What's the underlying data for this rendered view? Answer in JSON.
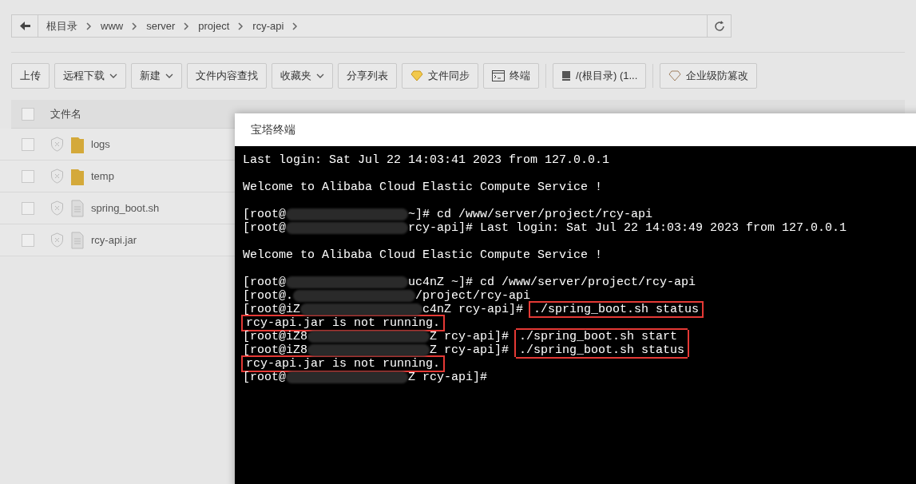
{
  "breadcrumb": [
    "根目录",
    "www",
    "server",
    "project",
    "rcy-api"
  ],
  "toolbar": [
    {
      "label": "上传",
      "kind": "plain"
    },
    {
      "label": "远程下载",
      "kind": "dropdown"
    },
    {
      "label": "新建",
      "kind": "dropdown"
    },
    {
      "label": "文件内容查找",
      "kind": "plain"
    },
    {
      "label": "收藏夹",
      "kind": "dropdown"
    },
    {
      "label": "分享列表",
      "kind": "plain"
    },
    {
      "label": "文件同步",
      "kind": "gem"
    },
    {
      "label": "终端",
      "kind": "terminal"
    },
    {
      "label": "/(根目录) (1...",
      "kind": "disk",
      "divider_before": true
    },
    {
      "label": "企业级防篡改",
      "kind": "shield",
      "divider_before": true
    }
  ],
  "table": {
    "columns": [
      "文件名"
    ],
    "all_checked": false,
    "rows": [
      {
        "name": "logs",
        "kind": "folder",
        "checked": false
      },
      {
        "name": "temp",
        "kind": "folder",
        "checked": false
      },
      {
        "name": "spring_boot.sh",
        "kind": "file",
        "checked": false
      },
      {
        "name": "rcy-api.jar",
        "kind": "file",
        "checked": false
      }
    ]
  },
  "terminal": {
    "title": "宝塔终端",
    "lines": [
      {
        "kind": "text",
        "parts": [
          {
            "kind": "plain",
            "text": "Last login: Sat Jul 22 14:03:41 2023 from 127.0.0.1"
          }
        ]
      },
      {
        "kind": "blank"
      },
      {
        "kind": "text",
        "parts": [
          {
            "kind": "plain",
            "text": "Welcome to Alibaba Cloud Elastic Compute Service !"
          }
        ]
      },
      {
        "kind": "blank"
      },
      {
        "kind": "text",
        "parts": [
          {
            "kind": "plain",
            "text": "[root@"
          },
          {
            "kind": "redacted"
          },
          {
            "kind": "plain",
            "text": "~]# cd /www/server/project/rcy-api"
          }
        ]
      },
      {
        "kind": "text",
        "parts": [
          {
            "kind": "plain",
            "text": "[root@"
          },
          {
            "kind": "redacted"
          },
          {
            "kind": "plain",
            "text": "rcy-api]# Last login: Sat Jul 22 14:03:49 2023 from 127.0.0.1"
          }
        ]
      },
      {
        "kind": "blank"
      },
      {
        "kind": "text",
        "parts": [
          {
            "kind": "plain",
            "text": "Welcome to Alibaba Cloud Elastic Compute Service !"
          }
        ]
      },
      {
        "kind": "blank"
      },
      {
        "kind": "text",
        "parts": [
          {
            "kind": "plain",
            "text": "[root@"
          },
          {
            "kind": "redacted"
          },
          {
            "kind": "plain",
            "text": "uc4nZ ~]# cd /www/server/project/rcy-api"
          }
        ]
      },
      {
        "kind": "text",
        "parts": [
          {
            "kind": "plain",
            "text": "[root@."
          },
          {
            "kind": "redacted"
          },
          {
            "kind": "plain",
            "text": "/project/rcy-api"
          }
        ]
      },
      {
        "kind": "text",
        "parts": [
          {
            "kind": "plain",
            "text": "[root@iZ"
          },
          {
            "kind": "redacted"
          },
          {
            "kind": "plain",
            "text": "c4nZ rcy-api]# "
          },
          {
            "kind": "boxed",
            "text": "./spring_boot.sh status"
          }
        ]
      },
      {
        "kind": "text",
        "parts": [
          {
            "kind": "boxed",
            "text": "rcy-api.jar is not running."
          }
        ]
      },
      {
        "kind": "text",
        "parts": [
          {
            "kind": "plain",
            "text": "[root@iZ8"
          },
          {
            "kind": "redacted"
          },
          {
            "kind": "plain",
            "text": "Z rcy-api]# "
          },
          {
            "kind": "box_top",
            "text": "./spring_boot.sh start "
          }
        ]
      },
      {
        "kind": "text",
        "parts": [
          {
            "kind": "plain",
            "text": "[root@iZ8"
          },
          {
            "kind": "redacted"
          },
          {
            "kind": "plain",
            "text": "Z rcy-api]# "
          },
          {
            "kind": "box_bottom",
            "text": "./spring_boot.sh status"
          }
        ]
      },
      {
        "kind": "text",
        "parts": [
          {
            "kind": "boxed",
            "text": "rcy-api.jar is not running."
          }
        ]
      },
      {
        "kind": "text",
        "parts": [
          {
            "kind": "plain",
            "text": "[root@"
          },
          {
            "kind": "redacted"
          },
          {
            "kind": "plain",
            "text": "Z rcy-api]#"
          }
        ]
      }
    ]
  }
}
